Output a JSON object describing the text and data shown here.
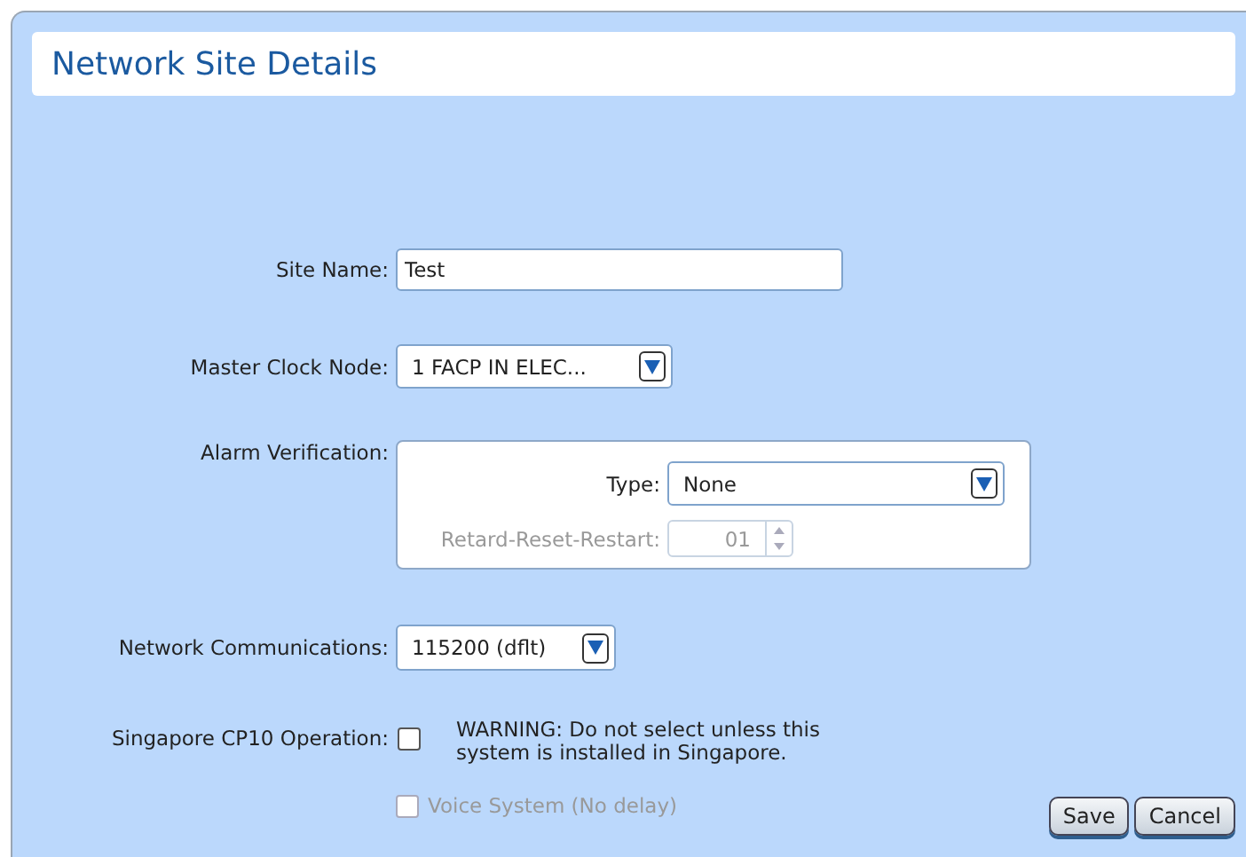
{
  "title": "Network Site Details",
  "site_name": {
    "label": "Site Name:",
    "value": "Test"
  },
  "master_clock": {
    "label": "Master Clock Node:",
    "value": "1 FACP IN ELEC..."
  },
  "alarm_verification": {
    "label": "Alarm Verification:",
    "type": {
      "label": "Type:",
      "value": "None"
    },
    "retard": {
      "label": "Retard-Reset-Restart:",
      "value": "01",
      "disabled": true
    }
  },
  "network_communications": {
    "label": "Network Communications:",
    "value": "115200 (dflt)"
  },
  "singapore": {
    "label": "Singapore CP10 Operation:",
    "checked": false,
    "warning": "WARNING: Do not select unless this system is installed in Singapore."
  },
  "voice_system": {
    "label": "Voice System (No delay)",
    "checked": false,
    "disabled": true
  },
  "buttons": [
    {
      "label": "Save"
    },
    {
      "label": "Cancel"
    }
  ]
}
